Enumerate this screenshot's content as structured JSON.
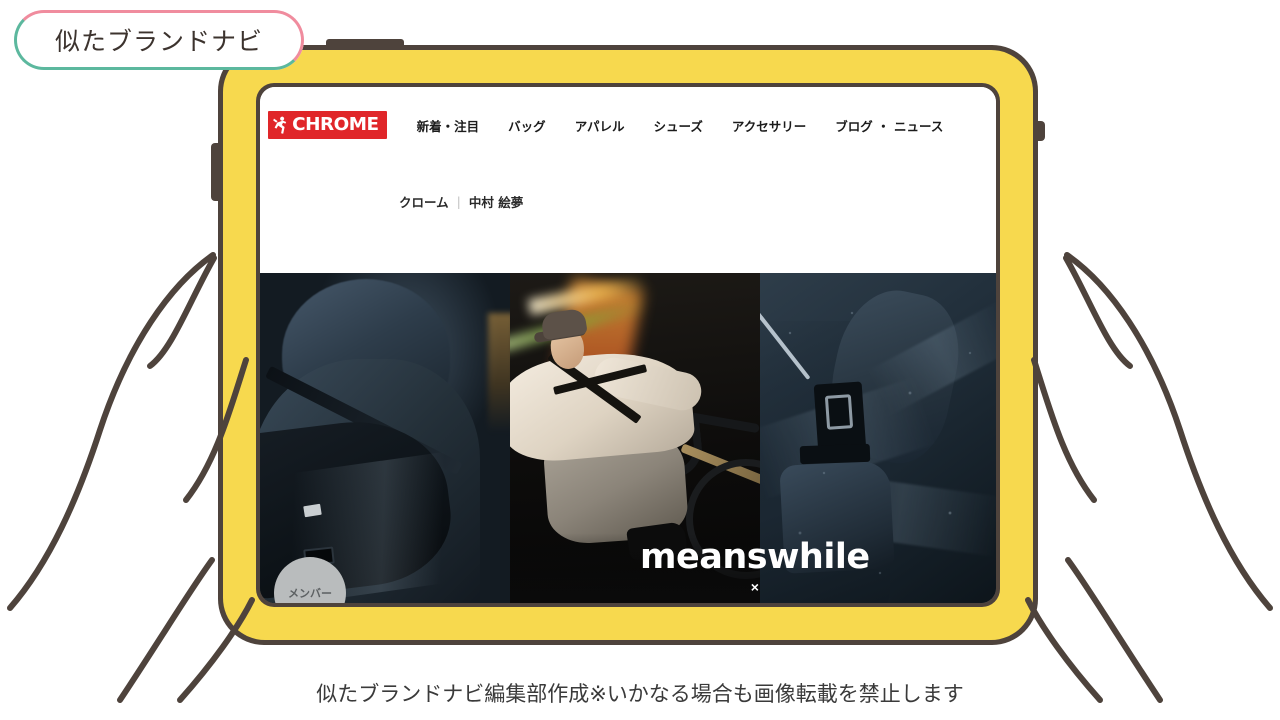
{
  "badge": {
    "label": "似たブランドナビ",
    "border_color_top": "#f08c9e",
    "border_color_bottom": "#5cb89e"
  },
  "device": {
    "type": "tablet",
    "frame_color": "#f7d94e",
    "outline_color": "#4e433c"
  },
  "site": {
    "logo": {
      "wordmark": "CHROME",
      "background_color": "#e02629",
      "text_color": "#ffffff"
    },
    "nav": [
      {
        "label": "新着・注目"
      },
      {
        "label": "バッグ"
      },
      {
        "label": "アパレル"
      },
      {
        "label": "シューズ"
      },
      {
        "label": "アクセサリー"
      },
      {
        "label": "ブログ ・ ニュース"
      }
    ],
    "breadcrumb": {
      "root": "クローム",
      "separator": "|",
      "current": "中村 絵夢"
    },
    "hero": {
      "brand_name": "meanswhile",
      "collab_mark": "×",
      "member_label": "メンバー",
      "panels": [
        {
          "alt": "dark-navy-hooded-rain-jacket-with-messenger-bag"
        },
        {
          "alt": "cyclist-in-cream-jacket-on-bike-at-night"
        },
        {
          "alt": "wet-navy-jacket-closeup-with-buckle"
        }
      ]
    }
  },
  "caption": "似たブランドナビ編集部作成※いかなる場合も画像転載を禁止します"
}
